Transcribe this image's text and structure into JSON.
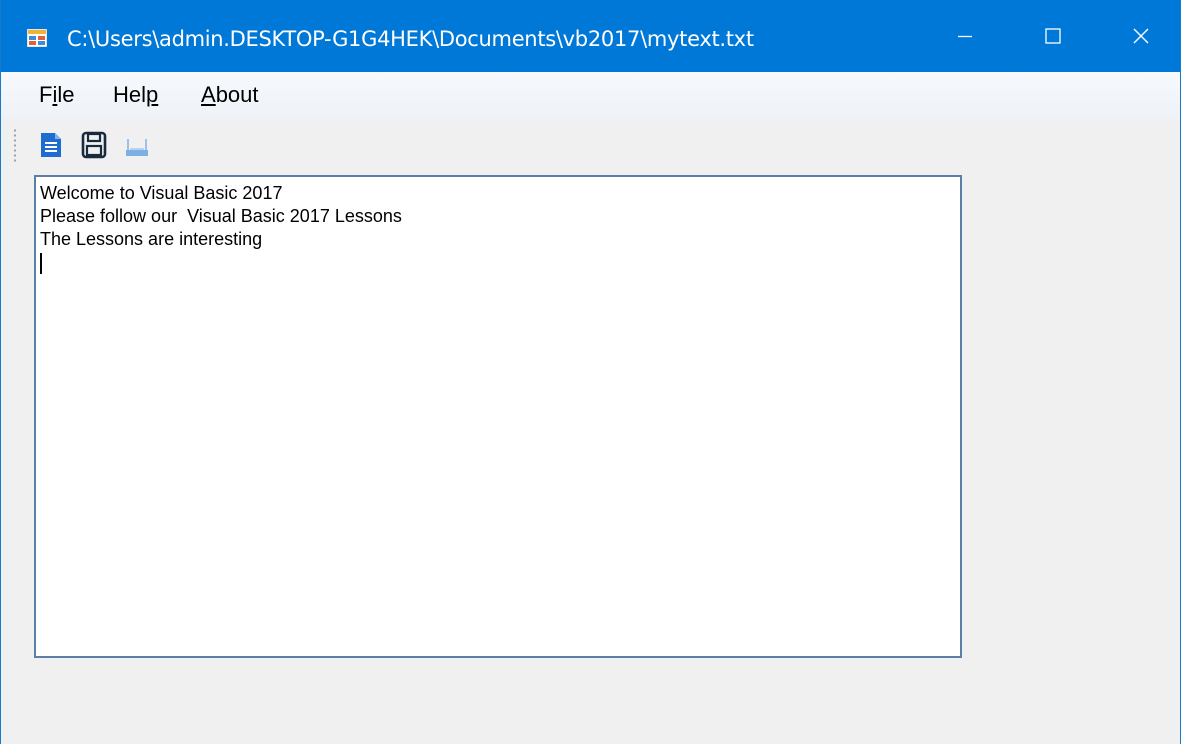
{
  "window": {
    "title": "C:\\Users\\admin.DESKTOP-G1G4HEK\\Documents\\vb2017\\mytext.txt",
    "icon": "app-form-icon",
    "controls": [
      "minimize-icon",
      "maximize-icon",
      "close-icon"
    ],
    "colors": {
      "titlebar": "#0078d7",
      "title_text": "#ffffff",
      "client": "#f0f0f0"
    }
  },
  "menu": {
    "file": {
      "pre": "F",
      "ul": "i",
      "post": "le"
    },
    "help": {
      "pre": "Hel",
      "ul": "p",
      "post": ""
    },
    "about": {
      "pre": "",
      "ul": "A",
      "post": "bout"
    }
  },
  "toolbar": {
    "buttons": [
      "new-document-icon",
      "save-disk-icon",
      "print-icon"
    ]
  },
  "editor": {
    "lines": [
      "Welcome to Visual Basic 2017",
      "Please follow our  Visual Basic 2017 Lessons",
      "The Lessons are interesting",
      ""
    ]
  }
}
